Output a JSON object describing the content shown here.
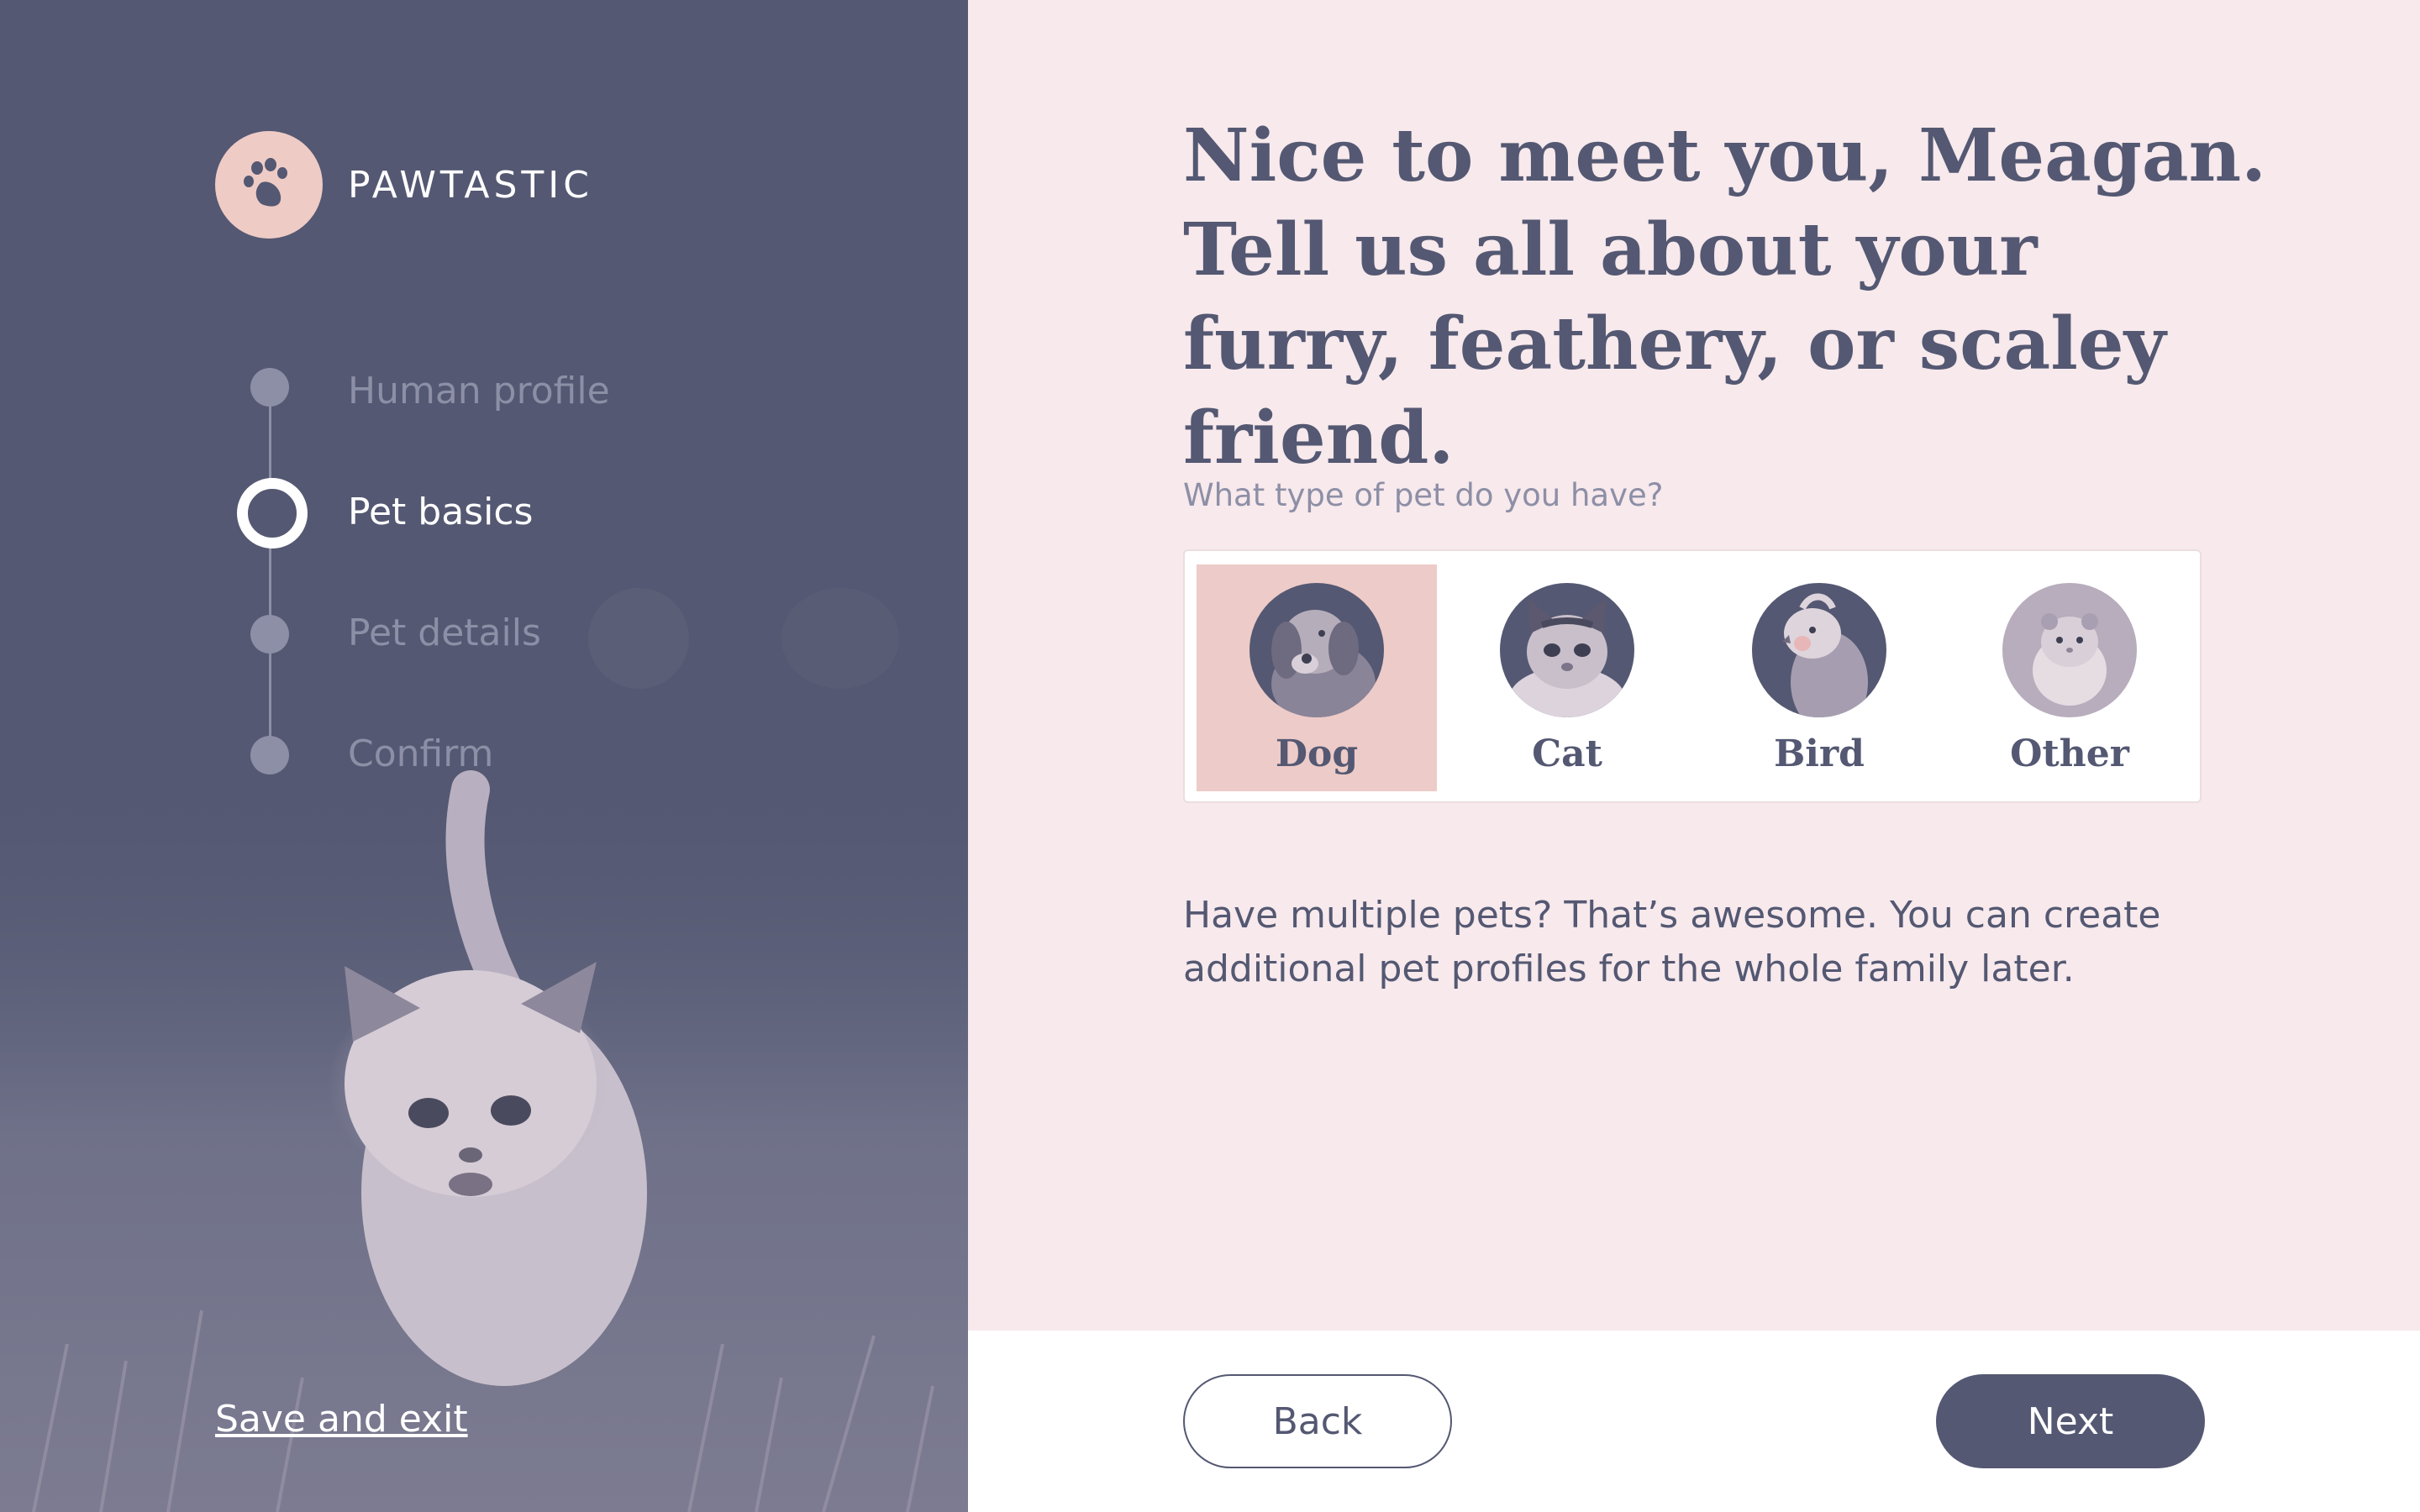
{
  "brand": {
    "name": "PAWTASTIC",
    "logo_icon": "paw-icon"
  },
  "steps": [
    {
      "label": "Human profile",
      "state": "complete"
    },
    {
      "label": "Pet basics",
      "state": "active"
    },
    {
      "label": "Pet details",
      "state": "upcoming"
    },
    {
      "label": "Confirm",
      "state": "upcoming"
    }
  ],
  "sidebar": {
    "save_exit_label": "Save and exit"
  },
  "main": {
    "headline": "Nice to meet you, Meagan. Tell us all about your furry, feathery, or scaley friend.",
    "question": "What type of pet do you have?",
    "pet_options": [
      {
        "label": "Dog",
        "selected": true,
        "image": "dog-photo"
      },
      {
        "label": "Cat",
        "selected": false,
        "image": "cat-photo"
      },
      {
        "label": "Bird",
        "selected": false,
        "image": "bird-photo"
      },
      {
        "label": "Other",
        "selected": false,
        "image": "hamster-photo"
      }
    ],
    "note": "Have multiple pets? That’s awesome. You can create additional pet profiles for the whole family later."
  },
  "footer": {
    "back_label": "Back",
    "next_label": "Next"
  },
  "colors": {
    "sidebar_bg": "#545872",
    "page_bg": "#f7e9ec",
    "accent_pink": "#edcbc8",
    "muted": "#8d8fa6",
    "text": "#545872"
  }
}
